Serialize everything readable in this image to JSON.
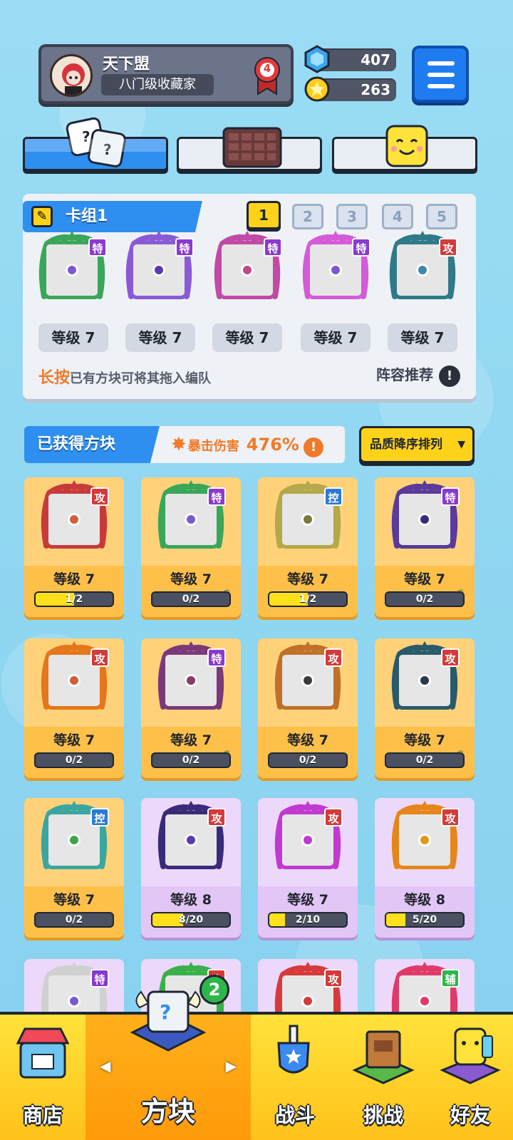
{
  "header": {
    "player_name": "天下盟",
    "player_title": "八门级收藏家",
    "rank": "4",
    "gems": "407",
    "coins": "263"
  },
  "deck": {
    "label": "卡组1",
    "slots": [
      "1",
      "2",
      "3",
      "4",
      "5"
    ],
    "active_slot": "1",
    "dice": [
      {
        "tag": "特",
        "level": "等级 7",
        "tag_color": "#8a3ad0",
        "color": "#3aa65a",
        "pip": "#7a5ad0"
      },
      {
        "tag": "特",
        "level": "等级 7",
        "tag_color": "#8a3ad0",
        "color": "#8a5ad6",
        "pip": "#5a3ab0"
      },
      {
        "tag": "特",
        "level": "等级 7",
        "tag_color": "#8a3ad0",
        "color": "#c04aa6",
        "pip": "#c04a86"
      },
      {
        "tag": "特",
        "level": "等级 7",
        "tag_color": "#8a3ad0",
        "color": "#d55ad8",
        "pip": "#7a5ad0"
      },
      {
        "tag": "攻",
        "level": "等级 7",
        "tag_color": "#d63a3a",
        "color": "#2e7a88",
        "pip": "#3a8ab0"
      }
    ],
    "hint_emphasis": "长按",
    "hint_text": "已有方块可将其拖入编队",
    "recommend_label": "阵容推荐",
    "info_symbol": "!"
  },
  "owned": {
    "label": "已获得方块",
    "crit_label": "暴击伤害",
    "crit_value": "476%",
    "info_symbol": "!",
    "sort_label": "品质降序排列",
    "cards": [
      {
        "tag": "攻",
        "tag_color": "#d63a3a",
        "level": "等级 7",
        "progress": "1/2",
        "fill": 0.5,
        "color": "#c83a3a",
        "pip": "#d0603a",
        "theme": "orange",
        "check": false
      },
      {
        "tag": "特",
        "tag_color": "#8a3ad0",
        "level": "等级 7",
        "progress": "0/2",
        "fill": 0,
        "color": "#3aa65a",
        "pip": "#7a5ad0",
        "theme": "orange",
        "check": true
      },
      {
        "tag": "控",
        "tag_color": "#2a7ad6",
        "level": "等级 7",
        "progress": "1/2",
        "fill": 0.5,
        "color": "#b3a84a",
        "pip": "#7a7a3a",
        "theme": "orange",
        "check": false
      },
      {
        "tag": "特",
        "tag_color": "#8a3ad0",
        "level": "等级 7",
        "progress": "0/2",
        "fill": 0,
        "color": "#5a3a9a",
        "pip": "#3a2a7a",
        "theme": "orange",
        "check": true
      },
      {
        "tag": "攻",
        "tag_color": "#d63a3a",
        "level": "等级 7",
        "progress": "0/2",
        "fill": 0,
        "color": "#e5761a",
        "pip": "#d0603a",
        "theme": "orange",
        "check": false
      },
      {
        "tag": "特",
        "tag_color": "#8a3ad0",
        "level": "等级 7",
        "progress": "0/2",
        "fill": 0,
        "color": "#7a3a7a",
        "pip": "#8a3a6a",
        "theme": "orange",
        "check": true
      },
      {
        "tag": "攻",
        "tag_color": "#d63a3a",
        "level": "等级 7",
        "progress": "0/2",
        "fill": 0,
        "color": "#c0702a",
        "pip": "#3a3a3a",
        "theme": "orange",
        "check": false
      },
      {
        "tag": "攻",
        "tag_color": "#d63a3a",
        "level": "等级 7",
        "progress": "0/2",
        "fill": 0,
        "color": "#2a5a6a",
        "pip": "#2a3a4a",
        "theme": "orange",
        "check": true
      },
      {
        "tag": "控",
        "tag_color": "#2a7ad6",
        "level": "等级 7",
        "progress": "0/2",
        "fill": 0,
        "color": "#3aa6a0",
        "pip": "#3aa64a",
        "theme": "orange",
        "check": false
      },
      {
        "tag": "攻",
        "tag_color": "#d63a3a",
        "level": "等级 8",
        "progress": "8/20",
        "fill": 0.4,
        "color": "#3a2a7a",
        "pip": "#5a3ab0",
        "theme": "purple",
        "check": false
      },
      {
        "tag": "攻",
        "tag_color": "#d63a3a",
        "level": "等级 7",
        "progress": "2/10",
        "fill": 0.2,
        "color": "#c03ad0",
        "pip": "#c03ad0",
        "theme": "purple",
        "check": false
      },
      {
        "tag": "攻",
        "tag_color": "#d63a3a",
        "level": "等级 8",
        "progress": "5/20",
        "fill": 0.25,
        "color": "#e5861a",
        "pip": "#e5961a",
        "theme": "purple",
        "check": false
      },
      {
        "tag": "特",
        "tag_color": "#8a3ad0",
        "level": "",
        "progress": "",
        "fill": 0,
        "color": "#d0d0d0",
        "pip": "#7a5ad0",
        "theme": "purple",
        "check": false
      },
      {
        "tag": "攻",
        "tag_color": "#d63a3a",
        "level": "",
        "progress": "",
        "fill": 0,
        "color": "#3ab04a",
        "pip": "#3ab04a",
        "theme": "purple",
        "check": false
      },
      {
        "tag": "攻",
        "tag_color": "#d63a3a",
        "level": "",
        "progress": "",
        "fill": 0,
        "color": "#d63a3a",
        "pip": "#d63a3a",
        "theme": "purple",
        "check": false
      },
      {
        "tag": "辅",
        "tag_color": "#2fb64a",
        "level": "",
        "progress": "",
        "fill": 0,
        "color": "#e03a6a",
        "pip": "#e03a6a",
        "theme": "purple",
        "check": false
      }
    ]
  },
  "bottom_nav": {
    "shop": "商店",
    "dice": "方块",
    "battle": "战斗",
    "challenge": "挑战",
    "friends": "好友",
    "dice_badge": "2"
  }
}
